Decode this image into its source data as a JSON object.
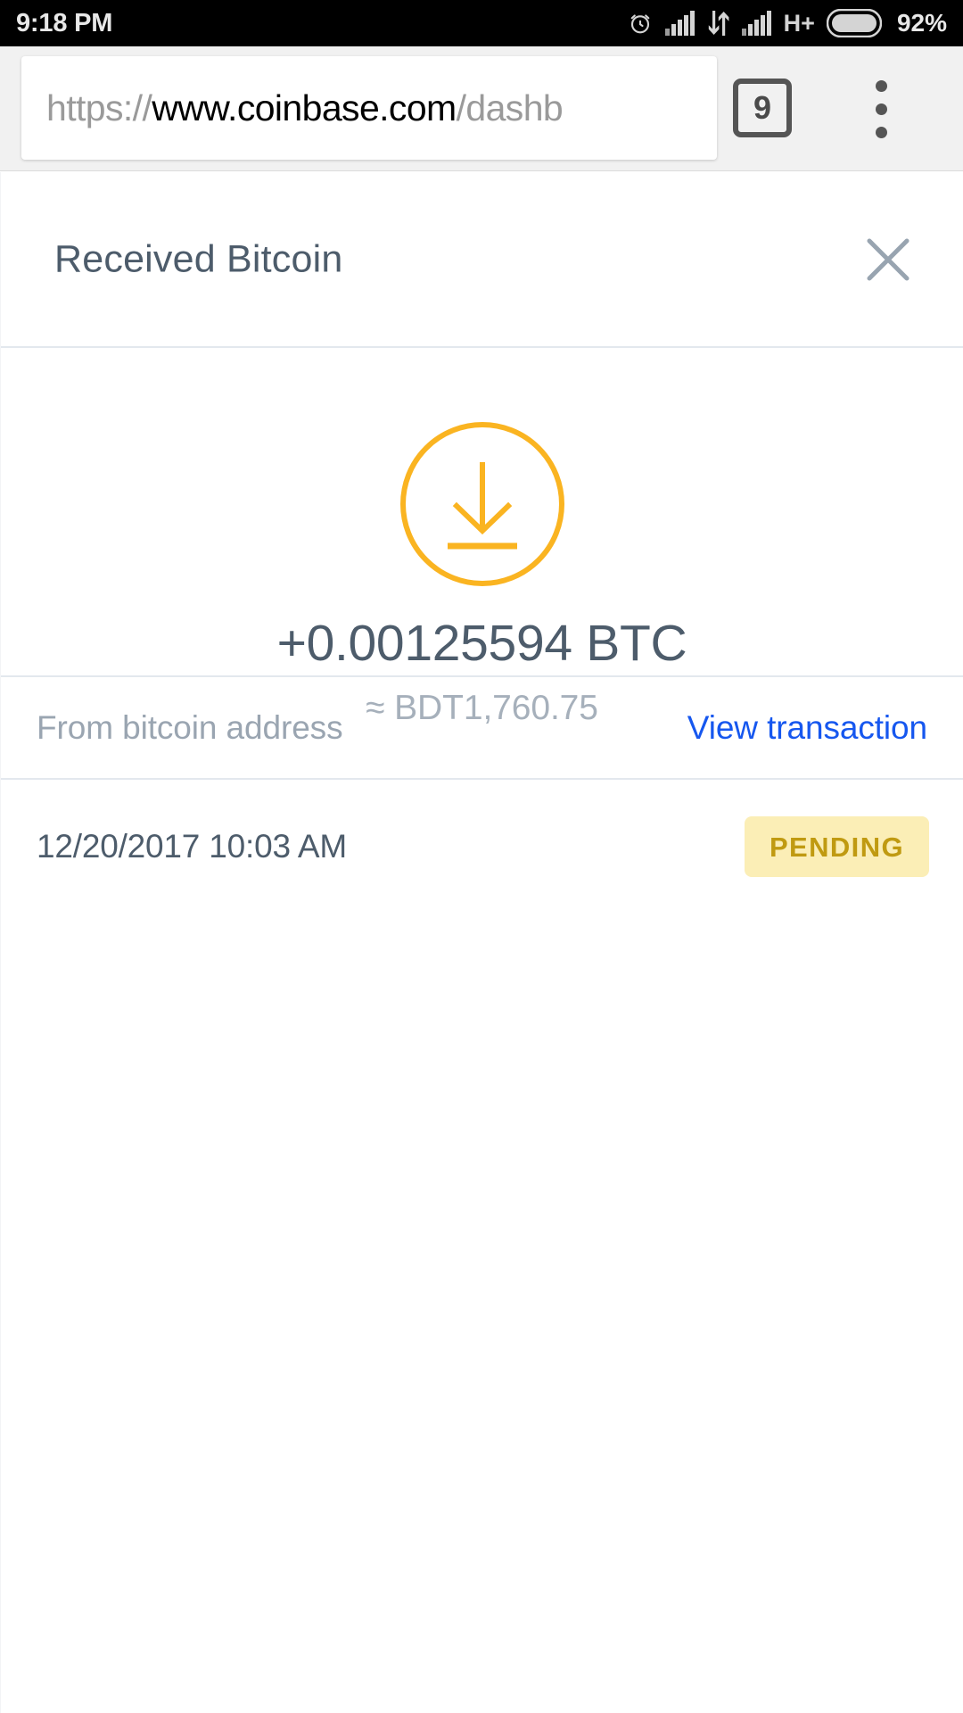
{
  "statusbar": {
    "time": "9:18 PM",
    "network_type": "H+",
    "battery_percent": "92%",
    "icons": [
      "alarm-clock-icon",
      "signal-bars-icon",
      "data-transfer-icon",
      "signal-bars-icon",
      "battery-icon"
    ]
  },
  "browser": {
    "url_scheme": "https://",
    "url_host": "www.coinbase.com",
    "url_path": "/dashb",
    "url_full_visible": "https://www.coinbase.com/dashb",
    "tab_count": "9",
    "menu_icon": "overflow-menu-icon"
  },
  "modal": {
    "title": "Received Bitcoin",
    "close_icon": "close-icon",
    "transaction": {
      "direction_icon": "download-arrow-icon",
      "amount": "+0.00125594 BTC",
      "fiat_approx": "≈ BDT1,760.75",
      "address_label": "From bitcoin address",
      "view_transaction_label": "View transaction",
      "timestamp": "12/20/2017 10:03 AM",
      "status": "PENDING"
    }
  },
  "colors": {
    "accent_orange": "#fab421",
    "link_blue": "#1657ef",
    "text_slate": "#4d5c6b",
    "text_muted": "#9aa5b1",
    "badge_bg": "#fbeeb6",
    "badge_text": "#c09a11",
    "divider": "#e3e8ee"
  }
}
